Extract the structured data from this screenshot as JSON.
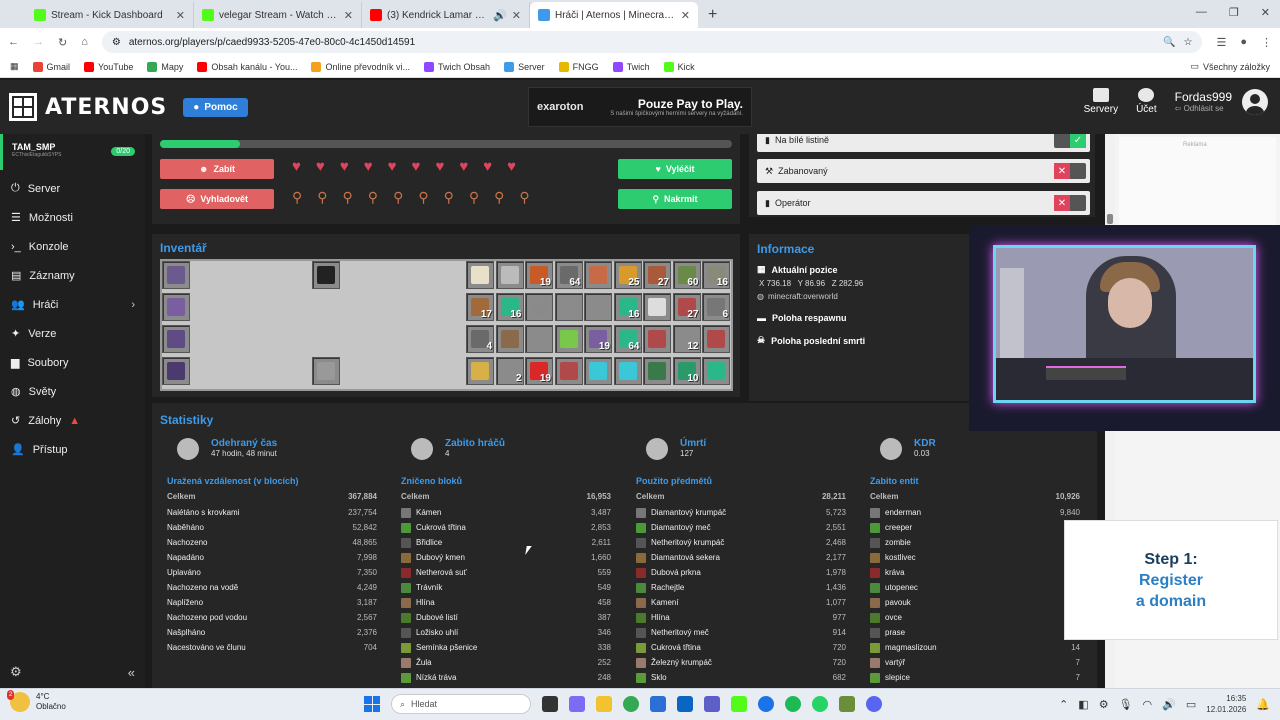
{
  "browser": {
    "tabs": [
      {
        "label": "Stream - Kick Dashboard",
        "color": "#53fc18",
        "active": false
      },
      {
        "label": "velegar Stream - Watch Live on",
        "color": "#53fc18",
        "active": false
      },
      {
        "label": "(3) Kendrick Lamar - luther",
        "color": "#ff0000",
        "active": false
      },
      {
        "label": "Hráči | Aternos | Minecraft Serv",
        "color": "#3d9be9",
        "active": true
      }
    ],
    "url": "aternos.org/players/p/caed9933-5205-47e0-80c0-4c1450d14591",
    "bookmarks": [
      {
        "label": "Gmail",
        "color": "#ea4335"
      },
      {
        "label": "YouTube",
        "color": "#ff0000"
      },
      {
        "label": "Mapy",
        "color": "#34a853"
      },
      {
        "label": "Obsah kanálu - You...",
        "color": "#ff0000"
      },
      {
        "label": "Online převodník vi...",
        "color": "#f4a020"
      },
      {
        "label": "Twich Obsah",
        "color": "#9146ff"
      },
      {
        "label": "Server",
        "color": "#3d9be9"
      },
      {
        "label": "FNGG",
        "color": "#e6b800"
      },
      {
        "label": "Twich",
        "color": "#9146ff"
      },
      {
        "label": "Kick",
        "color": "#53fc18"
      }
    ],
    "all_bookmarks": "Všechny záložky"
  },
  "header": {
    "logo": "ATERNOS",
    "help": "Pomoc",
    "ad_brand": "exaroton",
    "ad_title": "Pouze Pay to Play.",
    "ad_sub": "S našimi špičkovými herními servery na vyžádání.",
    "servers": "Servery",
    "account": "Účet",
    "username": "Fordas999",
    "logout": "Odhlásit se"
  },
  "sidebar": {
    "server_name": "TAM_SMP",
    "server_addr": "ECThisIEtagukbSYPS",
    "server_badge": "0/20",
    "items": [
      {
        "label": "Server"
      },
      {
        "label": "Možnosti"
      },
      {
        "label": "Konzole"
      },
      {
        "label": "Záznamy"
      },
      {
        "label": "Hráči"
      },
      {
        "label": "Verze"
      },
      {
        "label": "Soubory"
      },
      {
        "label": "Světy"
      },
      {
        "label": "Zálohy"
      },
      {
        "label": "Přístup"
      }
    ]
  },
  "player": {
    "kill": "Zabít",
    "starve": "Vyhladovět",
    "heal": "Vyléčit",
    "feed": "Nakrmit",
    "health_fraction": 1.0,
    "hunger_fraction": 1.0
  },
  "status": {
    "whitelist": "Na bílé listině",
    "banned": "Zabanovaný",
    "operator": "Operátor"
  },
  "inventory": {
    "title": "Inventář",
    "counts": [
      "",
      "",
      "19",
      "64",
      "",
      "25",
      "27",
      "60",
      "16",
      "17",
      "16",
      "",
      "",
      "",
      "16",
      "",
      "27",
      "6",
      "4",
      "",
      "",
      "",
      "19",
      "64",
      "",
      "12",
      "",
      "",
      "2",
      "19",
      "",
      "",
      "",
      "",
      "10"
    ]
  },
  "info": {
    "title": "Informace",
    "current_pos": "Aktuální pozice",
    "x_label": "X",
    "x": "736.18",
    "y_label": "Y",
    "y": "86.96",
    "z_label": "Z",
    "z": "282.96",
    "world": "minecraft:overworld",
    "respawn": "Poloha respawnu",
    "death": "Poloha poslední smrti"
  },
  "stats": {
    "title": "Statistiky",
    "heads": [
      {
        "label": "Odehraný čas",
        "value": "47 hodin, 48 minut"
      },
      {
        "label": "Zabito hráčů",
        "value": "4"
      },
      {
        "label": "Úmrtí",
        "value": "127"
      },
      {
        "label": "KDR",
        "value": "0.03"
      }
    ],
    "columns": [
      {
        "title": "Uražená vzdálenost (v blocích)",
        "total_label": "Celkem",
        "total": "367,884",
        "rows": [
          [
            "Nalétáno s krovkami",
            "237,754"
          ],
          [
            "Naběháno",
            "52,842"
          ],
          [
            "Nachozeno",
            "48,865"
          ],
          [
            "Napadáno",
            "7,998"
          ],
          [
            "Uplaváno",
            "7,350"
          ],
          [
            "Nachozeno na vodě",
            "4,249"
          ],
          [
            "Naplíženo",
            "3,187"
          ],
          [
            "Nachozeno pod vodou",
            "2,567"
          ],
          [
            "Našplháno",
            "2,376"
          ],
          [
            "Nacestováno ve člunu",
            "704"
          ]
        ]
      },
      {
        "title": "Zničeno bloků",
        "total_label": "Celkem",
        "total": "16,953",
        "rows": [
          [
            "Kámen",
            "3,487"
          ],
          [
            "Cukrová třtina",
            "2,853"
          ],
          [
            "Břidlice",
            "2,611"
          ],
          [
            "Dubový kmen",
            "1,660"
          ],
          [
            "Netherová suť",
            "559"
          ],
          [
            "Trávník",
            "549"
          ],
          [
            "Hlína",
            "458"
          ],
          [
            "Dubové listí",
            "387"
          ],
          [
            "Ložisko uhlí",
            "346"
          ],
          [
            "Semínka pšenice",
            "338"
          ],
          [
            "Žula",
            "252"
          ],
          [
            "Nízká tráva",
            "248"
          ]
        ]
      },
      {
        "title": "Použito předmětů",
        "total_label": "Celkem",
        "total": "28,211",
        "rows": [
          [
            "Diamantový krumpáč",
            "5,723"
          ],
          [
            "Diamantový meč",
            "2,551"
          ],
          [
            "Netheritový krumpáč",
            "2,468"
          ],
          [
            "Diamantová sekera",
            "2,177"
          ],
          [
            "Dubová prkna",
            "1,978"
          ],
          [
            "Rachejtle",
            "1,436"
          ],
          [
            "Kamení",
            "1,077"
          ],
          [
            "Hlína",
            "977"
          ],
          [
            "Netheritový meč",
            "914"
          ],
          [
            "Cukrová třtina",
            "720"
          ],
          [
            "Železný krumpáč",
            "720"
          ],
          [
            "Sklo",
            "682"
          ]
        ]
      },
      {
        "title": "Zabito entit",
        "total_label": "Celkem",
        "total": "10,926",
        "rows": [
          [
            "enderman",
            "9,840"
          ],
          [
            "creeper",
            ""
          ],
          [
            "zombie",
            ""
          ],
          [
            "kostlivec",
            ""
          ],
          [
            "kráva",
            ""
          ],
          [
            "utopenec",
            ""
          ],
          [
            "pavouk",
            ""
          ],
          [
            "ovce",
            ""
          ],
          [
            "prase",
            ""
          ],
          [
            "magmaslizoun",
            "14"
          ],
          [
            "vartýř",
            "7"
          ],
          [
            "slepice",
            "7"
          ]
        ]
      }
    ]
  },
  "right_ad": {
    "label": "Reklama",
    "step1": "Step 1:",
    "step2": "Register",
    "step3": "a domain"
  },
  "taskbar": {
    "temp": "4°C",
    "weather": "Oblačno",
    "badge": "2",
    "search": "Hledat",
    "time": "16:35",
    "date": "12.01.2026"
  }
}
